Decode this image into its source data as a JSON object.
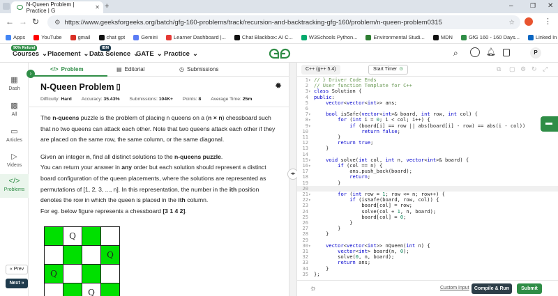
{
  "browser": {
    "tab_title": "N-Queen Problem | Practice | G",
    "url": "https://www.geeksforgeeks.org/batch/gfg-160-problems/track/recursion-and-backtracking-gfg-160/problem/n-queen-problem0315",
    "bookmarks": [
      "Apps",
      "YouTube",
      "gmail",
      "chat gpt",
      "Gemini",
      "Learner Dashboard |...",
      "Chat Blackbox: AI C...",
      "W3Schools Python...",
      "Environmental Studi...",
      "MDN",
      "GfG 160 - 160 Days...",
      "Linked In"
    ],
    "bookmark_colors": [
      "#4285f4",
      "#ff0000",
      "#d93025",
      "#111111",
      "#5b7cf5",
      "#e53935",
      "#111111",
      "#04aa6d",
      "#2e7d32",
      "#111111",
      "#2f8d46",
      "#0a66c2"
    ]
  },
  "sitenav": {
    "courses": "Courses",
    "courses_badge": "90% Refund",
    "placement": "Placement",
    "data_science": "Data Science",
    "ds_badge": "IBM",
    "gate": "GATE",
    "practice": "Practice",
    "avatar": "P"
  },
  "rail": {
    "items": [
      "Dash",
      "All",
      "Articles",
      "Videos",
      "Problems"
    ],
    "prev": "« Prev",
    "next": "Next »"
  },
  "problem_tabs": [
    "Problem",
    "Editorial",
    "Submissions"
  ],
  "problem": {
    "title": "N-Queen Problem",
    "difficulty_label": "Difficulty: ",
    "difficulty": "Hard",
    "accuracy_label": "Accuracy: ",
    "accuracy": "35.43%",
    "submissions_label": "Submissions: ",
    "submissions": "104K+",
    "points_label": "Points: ",
    "points": "8",
    "time_label": "Average Time: ",
    "time": "25m",
    "p1_a": "The ",
    "p1_b": "n-queens",
    "p1_c": " puzzle is the problem of placing n queens on a (",
    "p1_d": "n × n",
    "p1_e": ") chessboard such that no two queens can attack each other. Note that two queens attack each other if they are placed on the same row, the same column, or the same diagonal.",
    "p2_a": "Given an integer ",
    "p2_b": "n",
    "p2_c": ", find all distinct solutions to the ",
    "p2_d": "n-queens puzzle",
    "p2_e": ".",
    "p3_a": "You can return your answer in ",
    "p3_b": "any",
    "p3_c": " order but each solution should represent a distinct board configuration of the queen placements, where the solutions are represented as permutations of [1, 2, 3, ..., n]. In this representation, the number in the ",
    "p3_d": "ith",
    "p3_e": " position denotes the row in which the queen is placed in the ",
    "p3_f": "ith",
    "p3_g": " column.",
    "p4_a": "For eg. below figure represents a chessboard ",
    "p4_b": "[3 1 4 2]",
    "p4_c": ".",
    "queen_symbol": "Q",
    "board": [
      [
        0,
        1,
        0,
        0
      ],
      [
        0,
        0,
        0,
        1
      ],
      [
        1,
        0,
        0,
        0
      ],
      [
        0,
        0,
        1,
        0
      ]
    ]
  },
  "editor": {
    "language": "C++ (g++ 5.4)",
    "start_timer": "Start Timer",
    "lines": [
      "// } Driver Code Ends",
      "// User function Template for C++",
      "class Solution {",
      "public:",
      "    vector<vector<int>> ans;",
      "",
      "    bool isSafe(vector<int>& board, int row, int col) {",
      "        for (int i = 0; i < col; i++) {",
      "            if (board[i] == row || abs(board[i] - row) == abs(i - col))",
      "                return false;",
      "        }",
      "        return true;",
      "    }",
      "",
      "    void solve(int col, int n, vector<int>& board) {",
      "        if (col == n) {",
      "            ans.push_back(board);",
      "            return;",
      "        }",
      "",
      "        for (int row = 1; row <= n; row++) {",
      "            if (isSafe(board, row, col)) {",
      "                board[col] = row;",
      "                solve(col + 1, n, board);",
      "                board[col] = 0;",
      "            }",
      "        }",
      "    }",
      "",
      "    vector<vector<int>> nQueen(int n) {",
      "        vector<int> board(n, 0);",
      "        solve(0, n, board);",
      "        return ans;",
      "    }",
      "};"
    ],
    "foldable": [
      1,
      3,
      7,
      8,
      9,
      15,
      16,
      21,
      22,
      30
    ],
    "first_line_number": 1,
    "highlight_line": 20,
    "custom_input": "Custom Input",
    "compile_run": "Compile & Run",
    "submit": "Submit"
  },
  "colors": {
    "green": "#2f8d46",
    "dark": "#1f3b4d"
  }
}
